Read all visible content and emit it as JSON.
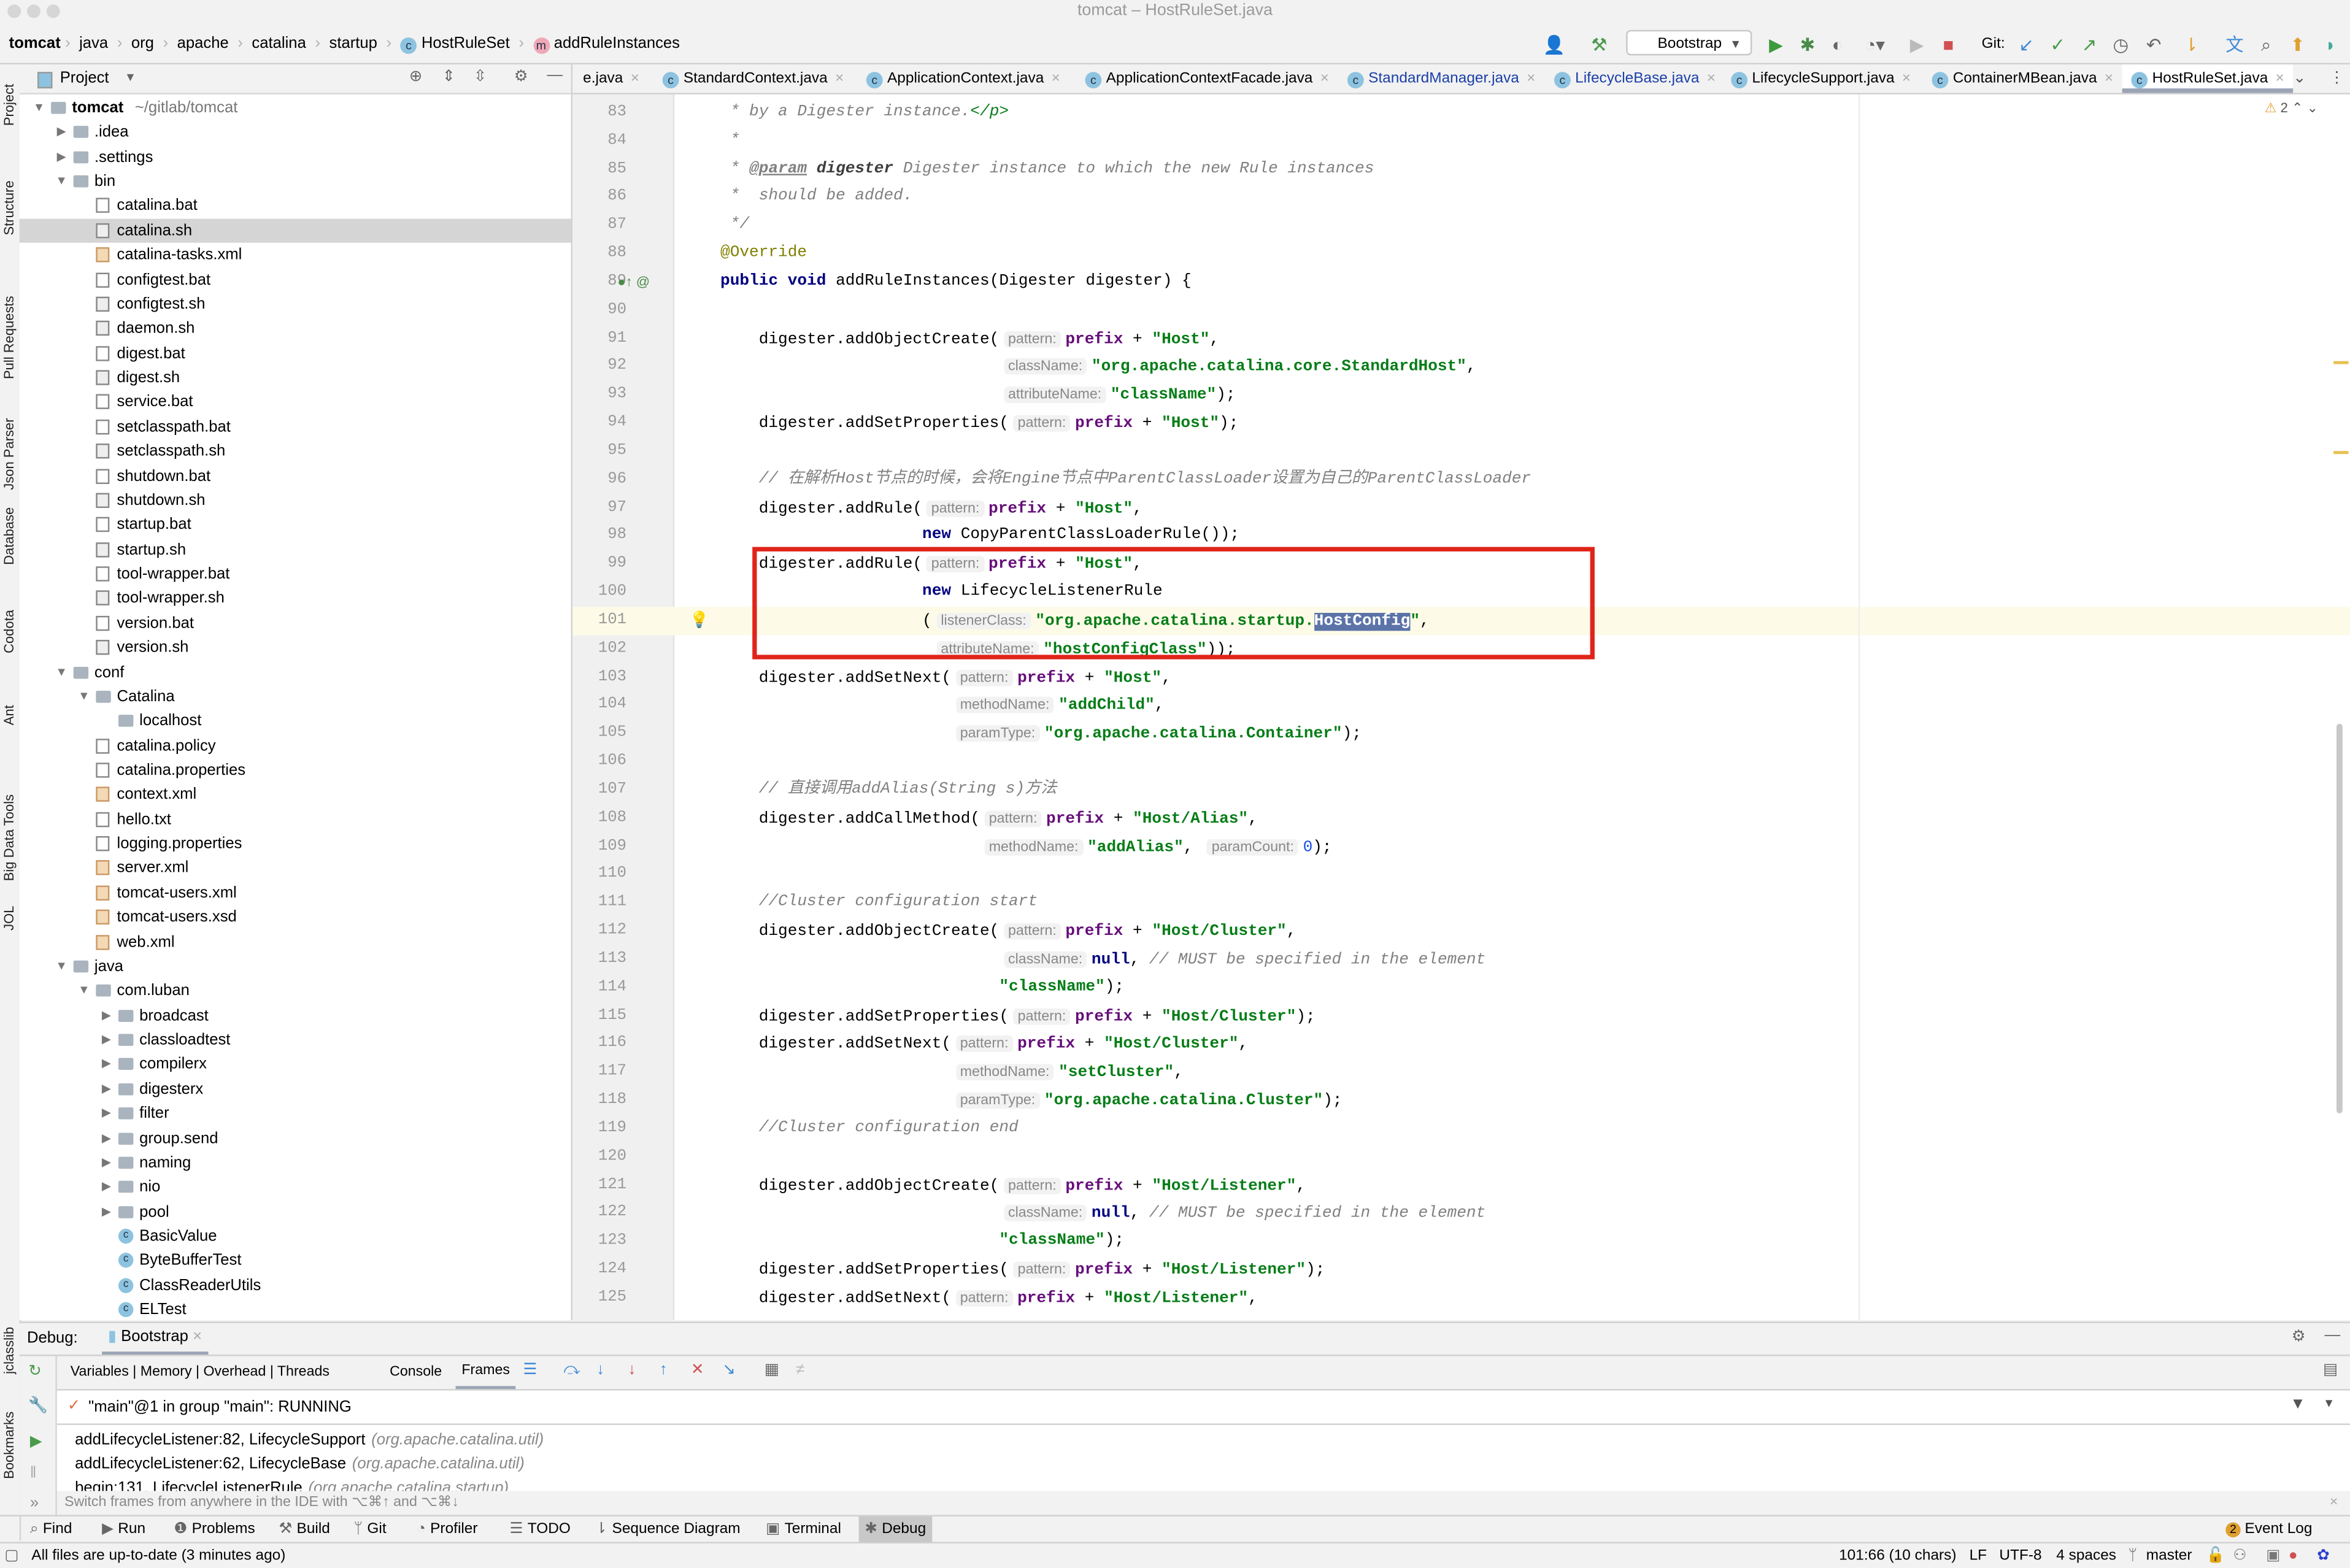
{
  "window_title": "tomcat – HostRuleSet.java",
  "breadcrumb": [
    "tomcat",
    "java",
    "org",
    "apache",
    "catalina",
    "startup",
    "HostRuleSet",
    "addRuleInstances"
  ],
  "toolbar": {
    "run_config": "Bootstrap",
    "git_label": "Git:"
  },
  "left_tool_tabs": [
    "Project",
    "Structure",
    "Pull Requests",
    "Json Parser",
    "Database",
    "Codota",
    "Ant",
    "Big Data Tools",
    "JOL",
    "jclasslib",
    "Bookmarks"
  ],
  "project_panel": {
    "title": "Project",
    "root_path": "~/gitlab/tomcat",
    "selected": "catalina.sh",
    "tree": [
      [
        "tomcat",
        0,
        "folder",
        "open"
      ],
      [
        ".idea",
        1,
        "folder",
        "closed"
      ],
      [
        ".settings",
        1,
        "folder",
        "closed"
      ],
      [
        "bin",
        1,
        "folder",
        "open"
      ],
      [
        "catalina.bat",
        2,
        "bat",
        ""
      ],
      [
        "catalina.sh",
        2,
        "sh",
        ""
      ],
      [
        "catalina-tasks.xml",
        2,
        "xml",
        ""
      ],
      [
        "configtest.bat",
        2,
        "bat",
        ""
      ],
      [
        "configtest.sh",
        2,
        "sh",
        ""
      ],
      [
        "daemon.sh",
        2,
        "sh",
        ""
      ],
      [
        "digest.bat",
        2,
        "bat",
        ""
      ],
      [
        "digest.sh",
        2,
        "sh",
        ""
      ],
      [
        "service.bat",
        2,
        "bat",
        ""
      ],
      [
        "setclasspath.bat",
        2,
        "bat",
        ""
      ],
      [
        "setclasspath.sh",
        2,
        "sh",
        ""
      ],
      [
        "shutdown.bat",
        2,
        "bat",
        ""
      ],
      [
        "shutdown.sh",
        2,
        "sh",
        ""
      ],
      [
        "startup.bat",
        2,
        "bat",
        ""
      ],
      [
        "startup.sh",
        2,
        "sh",
        ""
      ],
      [
        "tool-wrapper.bat",
        2,
        "bat",
        ""
      ],
      [
        "tool-wrapper.sh",
        2,
        "sh",
        ""
      ],
      [
        "version.bat",
        2,
        "bat",
        ""
      ],
      [
        "version.sh",
        2,
        "sh",
        ""
      ],
      [
        "conf",
        1,
        "folder",
        "open"
      ],
      [
        "Catalina",
        2,
        "folder",
        "open"
      ],
      [
        "localhost",
        3,
        "folder",
        ""
      ],
      [
        "catalina.policy",
        2,
        "bat",
        ""
      ],
      [
        "catalina.properties",
        2,
        "bat",
        ""
      ],
      [
        "context.xml",
        2,
        "xml",
        ""
      ],
      [
        "hello.txt",
        2,
        "bat",
        ""
      ],
      [
        "logging.properties",
        2,
        "bat",
        ""
      ],
      [
        "server.xml",
        2,
        "xml",
        ""
      ],
      [
        "tomcat-users.xml",
        2,
        "xml",
        ""
      ],
      [
        "tomcat-users.xsd",
        2,
        "xml",
        ""
      ],
      [
        "web.xml",
        2,
        "xml",
        ""
      ],
      [
        "java",
        1,
        "folder",
        "open"
      ],
      [
        "com.luban",
        2,
        "folder",
        "open"
      ],
      [
        "broadcast",
        3,
        "folder",
        "closed"
      ],
      [
        "classloadtest",
        3,
        "folder",
        "closed"
      ],
      [
        "compilerx",
        3,
        "folder",
        "closed"
      ],
      [
        "digesterx",
        3,
        "folder",
        "closed"
      ],
      [
        "filter",
        3,
        "folder",
        "closed"
      ],
      [
        "group.send",
        3,
        "folder",
        "closed"
      ],
      [
        "naming",
        3,
        "folder",
        "closed"
      ],
      [
        "nio",
        3,
        "folder",
        "closed"
      ],
      [
        "pool",
        3,
        "folder",
        "closed"
      ],
      [
        "BasicValue",
        3,
        "class",
        ""
      ],
      [
        "ByteBufferTest",
        3,
        "class",
        ""
      ],
      [
        "ClassReaderUtils",
        3,
        "class",
        ""
      ],
      [
        "ELTest",
        3,
        "class",
        ""
      ]
    ]
  },
  "editor_tabs": [
    {
      "label": "e.java",
      "style": "normal"
    },
    {
      "label": "StandardContext.java",
      "style": "normal"
    },
    {
      "label": "ApplicationContext.java",
      "style": "normal"
    },
    {
      "label": "ApplicationContextFacade.java",
      "style": "normal"
    },
    {
      "label": "StandardManager.java",
      "style": "blue"
    },
    {
      "label": "LifecycleBase.java",
      "style": "blue"
    },
    {
      "label": "LifecycleSupport.java",
      "style": "normal"
    },
    {
      "label": "ContainerMBean.java",
      "style": "normal"
    },
    {
      "label": "HostRuleSet.java",
      "style": "active"
    }
  ],
  "editor": {
    "warning_count": "2",
    "current_line": 101,
    "highlight_color": "#e0241a",
    "lines": [
      [
        83,
        [
          [
            "doc",
            "     * by a Digester instance."
          ],
          [
            "doctag",
            "</p>"
          ]
        ]
      ],
      [
        84,
        [
          [
            "doc",
            "     *"
          ]
        ]
      ],
      [
        85,
        [
          [
            "doc",
            "     * "
          ],
          [
            "docp",
            "@param"
          ],
          [
            "docb",
            " digester"
          ],
          [
            "doc",
            " Digester instance to which the new Rule instances"
          ]
        ]
      ],
      [
        86,
        [
          [
            "doc",
            "     *  should be added."
          ]
        ]
      ],
      [
        87,
        [
          [
            "doc",
            "     */"
          ]
        ]
      ],
      [
        88,
        [
          [
            "ann",
            "    @Override"
          ]
        ]
      ],
      [
        89,
        [
          [
            "kw",
            "    public void"
          ],
          [
            "p",
            " addRuleInstances(Digester digester) {"
          ]
        ]
      ],
      [
        90,
        []
      ],
      [
        91,
        [
          [
            "p",
            "        digester.addObjectCreate("
          ],
          [
            "hint",
            "pattern:"
          ],
          [
            "fld",
            "prefix"
          ],
          [
            "p",
            " + "
          ],
          [
            "str",
            "\"Host\""
          ],
          [
            "p",
            ","
          ]
        ]
      ],
      [
        92,
        [
          [
            "p",
            "                                 "
          ],
          [
            "hint",
            "className:"
          ],
          [
            "str",
            "\"org.apache.catalina.core.StandardHost\""
          ],
          [
            "p",
            ","
          ]
        ]
      ],
      [
        93,
        [
          [
            "p",
            "                                 "
          ],
          [
            "hint",
            "attributeName:"
          ],
          [
            "str",
            "\"className\""
          ],
          [
            "p",
            ");"
          ]
        ]
      ],
      [
        94,
        [
          [
            "p",
            "        digester.addSetProperties("
          ],
          [
            "hint",
            "pattern:"
          ],
          [
            "fld",
            "prefix"
          ],
          [
            "p",
            " + "
          ],
          [
            "str",
            "\"Host\""
          ],
          [
            "p",
            ");"
          ]
        ]
      ],
      [
        95,
        []
      ],
      [
        96,
        [
          [
            "cmt",
            "        // 在解析Host节点的时候，会将Engine节点中ParentClassLoader设置为自己的ParentClassLoader"
          ]
        ]
      ],
      [
        97,
        [
          [
            "p",
            "        digester.addRule("
          ],
          [
            "hint",
            "pattern:"
          ],
          [
            "fld",
            "prefix"
          ],
          [
            "p",
            " + "
          ],
          [
            "str",
            "\"Host\""
          ],
          [
            "p",
            ","
          ]
        ]
      ],
      [
        98,
        [
          [
            "p",
            "                         "
          ],
          [
            "kw",
            "new"
          ],
          [
            "p",
            " CopyParentClassLoaderRule());"
          ]
        ]
      ],
      [
        99,
        [
          [
            "p",
            "        digester.addRule("
          ],
          [
            "hint",
            "pattern:"
          ],
          [
            "fld",
            "prefix"
          ],
          [
            "p",
            " + "
          ],
          [
            "str",
            "\"Host\""
          ],
          [
            "p",
            ","
          ]
        ]
      ],
      [
        100,
        [
          [
            "p",
            "                         "
          ],
          [
            "kw",
            "new"
          ],
          [
            "p",
            " LifecycleListenerRule"
          ]
        ]
      ],
      [
        101,
        [
          [
            "p",
            "                         ("
          ],
          [
            "hint",
            "listenerClass:"
          ],
          [
            "str",
            "\"org.apache.catalina.startup."
          ],
          [
            "sel",
            "HostConfig"
          ],
          [
            "str",
            "\""
          ],
          [
            "p",
            ","
          ]
        ]
      ],
      [
        102,
        [
          [
            "p",
            "                          "
          ],
          [
            "hint",
            "attributeName:"
          ],
          [
            "str",
            "\"hostConfigClass\""
          ],
          [
            "p",
            "));"
          ]
        ]
      ],
      [
        103,
        [
          [
            "p",
            "        digester.addSetNext("
          ],
          [
            "hint",
            "pattern:"
          ],
          [
            "fld",
            "prefix"
          ],
          [
            "p",
            " + "
          ],
          [
            "str",
            "\"Host\""
          ],
          [
            "p",
            ","
          ]
        ]
      ],
      [
        104,
        [
          [
            "p",
            "                            "
          ],
          [
            "hint",
            "methodName:"
          ],
          [
            "str",
            "\"addChild\""
          ],
          [
            "p",
            ","
          ]
        ]
      ],
      [
        105,
        [
          [
            "p",
            "                            "
          ],
          [
            "hint",
            "paramType:"
          ],
          [
            "str",
            "\"org.apache.catalina.Container\""
          ],
          [
            "p",
            ");"
          ]
        ]
      ],
      [
        106,
        []
      ],
      [
        107,
        [
          [
            "cmt",
            "        // 直接调用addAlias(String s)方法"
          ]
        ]
      ],
      [
        108,
        [
          [
            "p",
            "        digester.addCallMethod("
          ],
          [
            "hint",
            "pattern:"
          ],
          [
            "fld",
            "prefix"
          ],
          [
            "p",
            " + "
          ],
          [
            "str",
            "\"Host/Alias\""
          ],
          [
            "p",
            ","
          ]
        ]
      ],
      [
        109,
        [
          [
            "p",
            "                               "
          ],
          [
            "hint",
            "methodName:"
          ],
          [
            "str",
            "\"addAlias\""
          ],
          [
            "p",
            ", "
          ],
          [
            "hint",
            "paramCount:"
          ],
          [
            "num",
            "0"
          ],
          [
            "p",
            ");"
          ]
        ]
      ],
      [
        110,
        []
      ],
      [
        111,
        [
          [
            "cmt",
            "        //Cluster configuration start"
          ]
        ]
      ],
      [
        112,
        [
          [
            "p",
            "        digester.addObjectCreate("
          ],
          [
            "hint",
            "pattern:"
          ],
          [
            "fld",
            "prefix"
          ],
          [
            "p",
            " + "
          ],
          [
            "str",
            "\"Host/Cluster\""
          ],
          [
            "p",
            ","
          ]
        ]
      ],
      [
        113,
        [
          [
            "p",
            "                                 "
          ],
          [
            "hint",
            "className:"
          ],
          [
            "kw",
            "null"
          ],
          [
            "p",
            ", "
          ],
          [
            "cmt",
            "// MUST be specified in the element"
          ]
        ]
      ],
      [
        114,
        [
          [
            "p",
            "                                 "
          ],
          [
            "str",
            "\"className\""
          ],
          [
            "p",
            ");"
          ]
        ]
      ],
      [
        115,
        [
          [
            "p",
            "        digester.addSetProperties("
          ],
          [
            "hint",
            "pattern:"
          ],
          [
            "fld",
            "prefix"
          ],
          [
            "p",
            " + "
          ],
          [
            "str",
            "\"Host/Cluster\""
          ],
          [
            "p",
            ");"
          ]
        ]
      ],
      [
        116,
        [
          [
            "p",
            "        digester.addSetNext("
          ],
          [
            "hint",
            "pattern:"
          ],
          [
            "fld",
            "prefix"
          ],
          [
            "p",
            " + "
          ],
          [
            "str",
            "\"Host/Cluster\""
          ],
          [
            "p",
            ","
          ]
        ]
      ],
      [
        117,
        [
          [
            "p",
            "                            "
          ],
          [
            "hint",
            "methodName:"
          ],
          [
            "str",
            "\"setCluster\""
          ],
          [
            "p",
            ","
          ]
        ]
      ],
      [
        118,
        [
          [
            "p",
            "                            "
          ],
          [
            "hint",
            "paramType:"
          ],
          [
            "str",
            "\"org.apache.catalina.Cluster\""
          ],
          [
            "p",
            ");"
          ]
        ]
      ],
      [
        119,
        [
          [
            "cmt",
            "        //Cluster configuration end"
          ]
        ]
      ],
      [
        120,
        []
      ],
      [
        121,
        [
          [
            "p",
            "        digester.addObjectCreate("
          ],
          [
            "hint",
            "pattern:"
          ],
          [
            "fld",
            "prefix"
          ],
          [
            "p",
            " + "
          ],
          [
            "str",
            "\"Host/Listener\""
          ],
          [
            "p",
            ","
          ]
        ]
      ],
      [
        122,
        [
          [
            "p",
            "                                 "
          ],
          [
            "hint",
            "className:"
          ],
          [
            "kw",
            "null"
          ],
          [
            "p",
            ", "
          ],
          [
            "cmt",
            "// MUST be specified in the element"
          ]
        ]
      ],
      [
        123,
        [
          [
            "p",
            "                                 "
          ],
          [
            "str",
            "\"className\""
          ],
          [
            "p",
            ");"
          ]
        ]
      ],
      [
        124,
        [
          [
            "p",
            "        digester.addSetProperties("
          ],
          [
            "hint",
            "pattern:"
          ],
          [
            "fld",
            "prefix"
          ],
          [
            "p",
            " + "
          ],
          [
            "str",
            "\"Host/Listener\""
          ],
          [
            "p",
            ");"
          ]
        ]
      ],
      [
        125,
        [
          [
            "p",
            "        digester.addSetNext("
          ],
          [
            "hint",
            "pattern:"
          ],
          [
            "fld",
            "prefix"
          ],
          [
            "p",
            " + "
          ],
          [
            "str",
            "\"Host/Listener\""
          ],
          [
            "p",
            ","
          ]
        ]
      ]
    ]
  },
  "debug": {
    "label": "Debug:",
    "session": "Bootstrap",
    "tabs": [
      "Variables | Memory | Overhead | Threads",
      "Console",
      "Frames"
    ],
    "active_tab": "Frames",
    "thread": "\"main\"@1 in group \"main\": RUNNING",
    "frames": [
      {
        "method": "addLifecycleListener:82, LifecycleSupport",
        "pkg": "(org.apache.catalina.util)"
      },
      {
        "method": "addLifecycleListener:62, LifecycleBase",
        "pkg": "(org.apache.catalina.util)"
      },
      {
        "method": "begin:131, LifecycleListenerRule",
        "pkg": "(org.apache.catalina.startup)"
      }
    ],
    "hint": "Switch frames from anywhere in the IDE with ⌥⌘↑ and ⌥⌘↓"
  },
  "bottom_tools": [
    "Find",
    "Run",
    "Problems",
    "Build",
    "Git",
    "Profiler",
    "TODO",
    "Sequence Diagram",
    "Terminal",
    "Debug"
  ],
  "event_log": {
    "count": "2",
    "label": "Event Log"
  },
  "status": {
    "message": "All files are up-to-date (3 minutes ago)",
    "position": "101:66 (10 chars)",
    "line_sep": "LF",
    "encoding": "UTF-8",
    "indent": "4 spaces",
    "branch": "master"
  }
}
